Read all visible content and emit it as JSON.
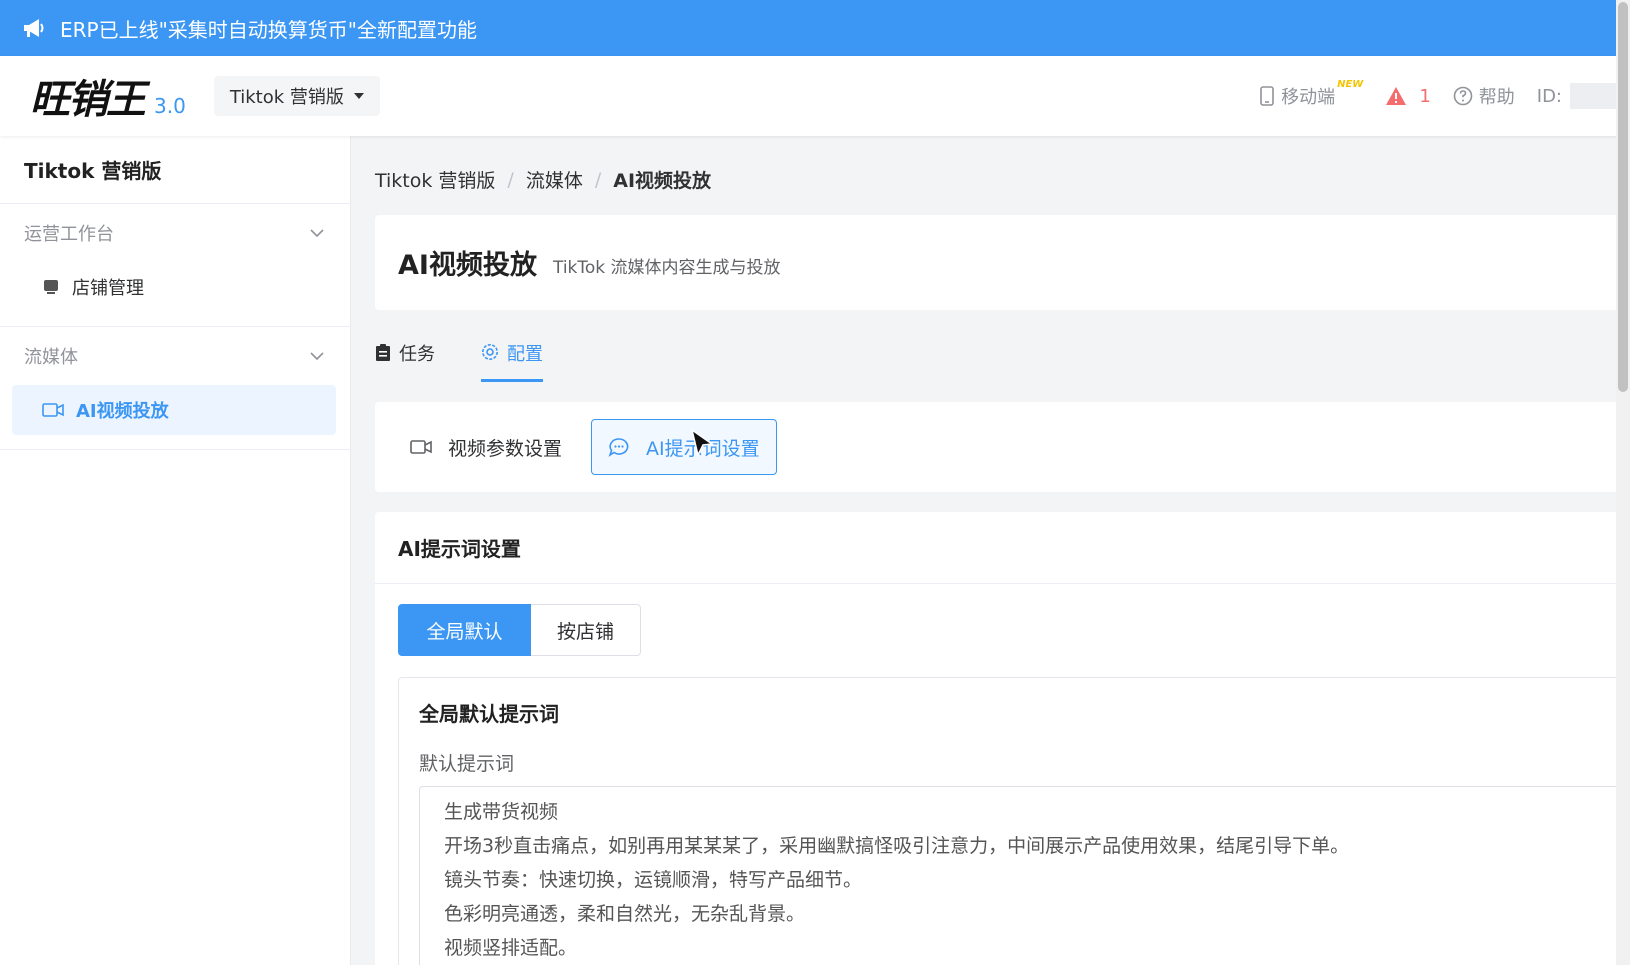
{
  "announcement": {
    "text": "ERP已上线\"采集时自动换算货币\"全新配置功能"
  },
  "header": {
    "logo_text": "旺销王",
    "logo_version": "3.0",
    "version_select": "Tiktok 营销版",
    "mobile_label": "移动端",
    "new_badge": "NEW",
    "warning_count": "1",
    "help_label": "帮助",
    "id_label": "ID:"
  },
  "sidebar": {
    "title": "Tiktok 营销版",
    "groups": [
      {
        "label": "运营工作台",
        "items": [
          {
            "label": "店铺管理",
            "icon": "store-icon"
          }
        ]
      },
      {
        "label": "流媒体",
        "items": [
          {
            "label": "AI视频投放",
            "icon": "video-camera-icon",
            "active": true
          }
        ]
      }
    ]
  },
  "breadcrumb": [
    "Tiktok 营销版",
    "流媒体",
    "AI视频投放"
  ],
  "page": {
    "title": "AI视频投放",
    "subtitle": "TikTok 流媒体内容生成与投放"
  },
  "tabs": [
    {
      "label": "任务",
      "icon": "clipboard-icon"
    },
    {
      "label": "配置",
      "icon": "gear-icon",
      "active": true
    }
  ],
  "sub_tabs": [
    {
      "label": "视频参数设置",
      "icon": "video-camera-icon"
    },
    {
      "label": "AI提示词设置",
      "icon": "chat-bubble-icon",
      "active": true
    }
  ],
  "settings": {
    "title": "AI提示词设置",
    "segments": [
      {
        "label": "全局默认",
        "active": true
      },
      {
        "label": "按店铺"
      }
    ],
    "prompt_section_title": "全局默认提示词",
    "prompt_label": "默认提示词",
    "prompt_lines": [
      "生成带货视频",
      "开场3秒直击痛点，如别再用某某某了，采用幽默搞怪吸引注意力，中间展示产品使用效果，结尾引导下单。",
      "镜头节奏：快速切换，运镜顺滑，特写产品细节。",
      "色彩明亮通透，柔和自然光，无杂乱背景。",
      "视频竖排适配。"
    ]
  },
  "colors": {
    "primary": "#3c96f3",
    "warning": "#f56c6c",
    "badge": "#f5c400"
  }
}
